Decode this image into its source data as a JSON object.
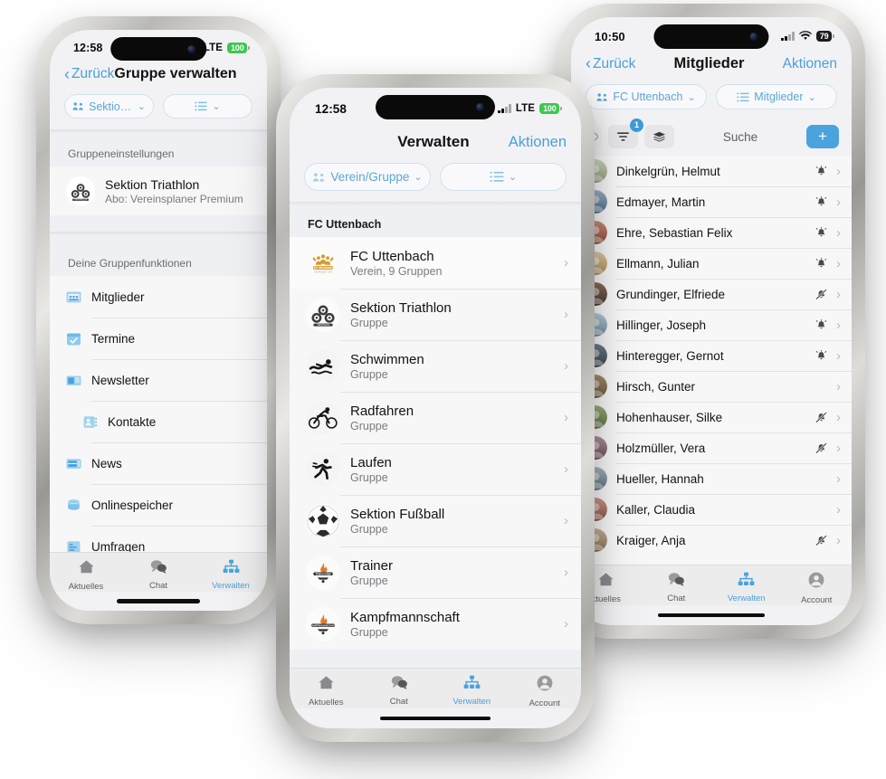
{
  "phones": {
    "left": {
      "status": {
        "time": "12:58",
        "network": "LTE",
        "battery": "100"
      },
      "nav": {
        "back": "Zurück",
        "title": "Gruppe verwalten"
      },
      "chips": [
        {
          "label": "Sektion Triathl...",
          "icon": "group-icon"
        },
        {
          "label": "",
          "icon": "list-filter-icon"
        }
      ],
      "sections": [
        {
          "header": "Gruppeneinstellungen"
        },
        {
          "header": "Deine Gruppenfunktionen"
        }
      ],
      "group_setting": {
        "title": "Sektion Triathlon",
        "subtitle": "Abo: Vereinsplaner Premium",
        "logo": "triathlon-logo"
      },
      "functions": [
        {
          "label": "Mitglieder",
          "icon": "members-icon",
          "indent": false
        },
        {
          "label": "Termine",
          "icon": "calendar-icon",
          "indent": false
        },
        {
          "label": "Newsletter",
          "icon": "newsletter-icon",
          "indent": false
        },
        {
          "label": "Kontakte",
          "icon": "contacts-icon",
          "indent": true
        },
        {
          "label": "News",
          "icon": "news-icon",
          "indent": false
        },
        {
          "label": "Onlinespeicher",
          "icon": "database-icon",
          "indent": false
        },
        {
          "label": "Umfragen",
          "icon": "survey-icon",
          "indent": false
        }
      ],
      "tabs": [
        {
          "label": "Aktuelles",
          "icon": "home-icon",
          "active": false
        },
        {
          "label": "Chat",
          "icon": "chat-icon",
          "active": false
        },
        {
          "label": "Verwalten",
          "icon": "org-icon",
          "active": true
        }
      ]
    },
    "center": {
      "status": {
        "time": "12:58",
        "network": "LTE",
        "battery": "100"
      },
      "nav": {
        "back": "",
        "title": "Verwalten",
        "action": "Aktionen"
      },
      "chips": [
        {
          "label": "Verein/Gruppe",
          "icon": "group-icon"
        },
        {
          "label": "",
          "icon": "list-filter-icon"
        }
      ],
      "section_header": "FC Uttenbach",
      "groups": [
        {
          "title": "FC Uttenbach",
          "subtitle": "Verein, 9 Gruppen",
          "logo": "fc-uttenbach-logo",
          "highlight": true
        },
        {
          "title": "Sektion Triathlon",
          "subtitle": "Gruppe",
          "logo": "triathlon-logo"
        },
        {
          "title": "Schwimmen",
          "subtitle": "Gruppe",
          "logo": "swimmer-logo"
        },
        {
          "title": "Radfahren",
          "subtitle": "Gruppe",
          "logo": "cyclist-logo"
        },
        {
          "title": "Laufen",
          "subtitle": "Gruppe",
          "logo": "runner-logo"
        },
        {
          "title": "Sektion Fußball",
          "subtitle": "Gruppe",
          "logo": "football-logo"
        },
        {
          "title": "Trainer",
          "subtitle": "Gruppe",
          "logo": "trainerstab-logo"
        },
        {
          "title": "Kampfmannschaft",
          "subtitle": "Gruppe",
          "logo": "kampfmannschaft-logo"
        }
      ],
      "tabs": [
        {
          "label": "Aktuelles",
          "icon": "home-icon",
          "active": false
        },
        {
          "label": "Chat",
          "icon": "chat-icon",
          "active": false
        },
        {
          "label": "Verwalten",
          "icon": "org-icon",
          "active": true
        },
        {
          "label": "Account",
          "icon": "account-icon",
          "active": false
        }
      ]
    },
    "right": {
      "status": {
        "time": "10:50",
        "network": "wifi",
        "battery": "79"
      },
      "nav": {
        "back": "Zurück",
        "title": "Mitglieder",
        "action": "Aktionen"
      },
      "chips": [
        {
          "label": "FC Uttenbach",
          "icon": "group-icon"
        },
        {
          "label": "Mitglieder",
          "icon": "list-filter-icon"
        }
      ],
      "toolbar": {
        "eye_icon": "eye-icon",
        "filter_icon": "filter-icon",
        "filter_badge": "1",
        "layers_icon": "layers-icon",
        "search_label": "Suche",
        "add_label": "+"
      },
      "members": [
        {
          "name": "Dinkelgrün, Helmut",
          "bell": "bell-on"
        },
        {
          "name": "Edmayer, Martin",
          "bell": "bell-on"
        },
        {
          "name": "Ehre, Sebastian Felix",
          "bell": "bell-on"
        },
        {
          "name": "Ellmann, Julian",
          "bell": "bell-on"
        },
        {
          "name": "Grundinger, Elfriede",
          "bell": "bell-off"
        },
        {
          "name": "Hillinger, Joseph",
          "bell": "bell-on"
        },
        {
          "name": "Hinteregger, Gernot",
          "bell": "bell-on"
        },
        {
          "name": "Hirsch, Gunter",
          "bell": "none"
        },
        {
          "name": "Hohenhauser, Silke",
          "bell": "bell-off"
        },
        {
          "name": "Holzmüller, Vera",
          "bell": "bell-off"
        },
        {
          "name": "Hueller, Hannah",
          "bell": "none"
        },
        {
          "name": "Kaller, Claudia",
          "bell": "none"
        },
        {
          "name": "Kraiger, Anja",
          "bell": "bell-off"
        }
      ],
      "tabs": [
        {
          "label": "ktuelles",
          "icon": "home-icon",
          "active": false
        },
        {
          "label": "Chat",
          "icon": "chat-icon",
          "active": false
        },
        {
          "label": "Verwalten",
          "icon": "org-icon",
          "active": true
        },
        {
          "label": "Account",
          "icon": "account-icon",
          "active": false
        }
      ]
    }
  },
  "colors": {
    "accent": "#4ba3de",
    "chip_border": "#cfe2ef",
    "battery_green": "#3cc74f",
    "screen_bg": "#f2f2f5",
    "card_bg": "#f7f7f8"
  }
}
